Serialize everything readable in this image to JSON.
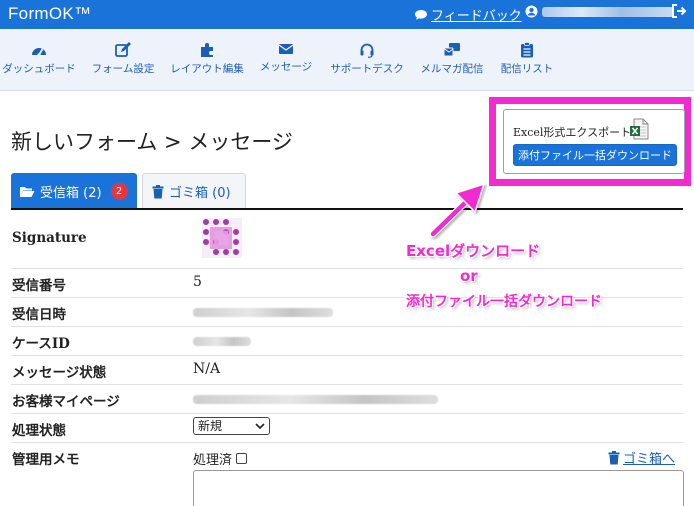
{
  "app": {
    "brand": "FormOK™",
    "feedback_label": "フィードバック"
  },
  "nav": {
    "items": [
      {
        "label": "ダッシュボード",
        "icon": "dashboard-icon"
      },
      {
        "label": "フォーム設定",
        "icon": "edit-icon"
      },
      {
        "label": "レイアウト編集",
        "icon": "puzzle-icon"
      },
      {
        "label": "メッセージ",
        "icon": "envelope-icon"
      },
      {
        "label": "サポートデスク",
        "icon": "headset-icon"
      },
      {
        "label": "メルマガ配信",
        "icon": "mail-bulk-icon"
      },
      {
        "label": "配信リスト",
        "icon": "clipboard-list-icon"
      }
    ]
  },
  "page": {
    "title": "新しいフォーム > メッセージ"
  },
  "export": {
    "label": "Excel形式エクスポート",
    "download_button": "添付ファイル一括ダウンロード"
  },
  "tabs": {
    "inbox_label": "受信箱 (2)",
    "inbox_badge": "2",
    "trash_label": "ゴミ箱 (0)"
  },
  "details": {
    "signature_label": "Signature",
    "receipt_number_label": "受信番号",
    "receipt_number_value": "5",
    "received_at_label": "受信日時",
    "case_id_label": "ケースID",
    "message_status_label": "メッセージ状態",
    "message_status_value": "N/A",
    "customer_page_label": "お客様マイページ",
    "process_status_label": "処理状態",
    "process_status_value": "新規",
    "admin_memo_label": "管理用メモ",
    "processed_label": "処理済",
    "to_trash_label": "ゴミ箱へ"
  },
  "annotation": {
    "line1": "Excelダウンロード",
    "line2": "or",
    "line3": "添付ファイル一括ダウンロード"
  },
  "colors": {
    "primary": "#1a73d9",
    "highlight": "#f22ad0",
    "badge": "#e5353f"
  }
}
